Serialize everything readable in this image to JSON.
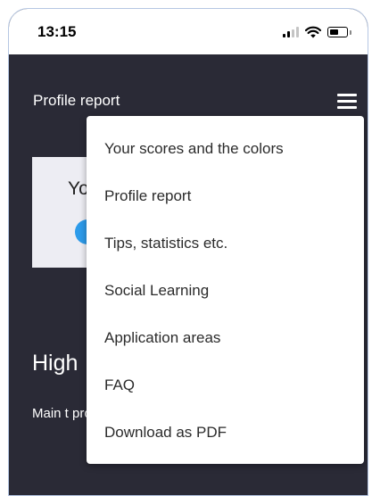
{
  "status_bar": {
    "time": "13:15",
    "icons": [
      "signal-icon",
      "wifi-icon",
      "battery-icon"
    ]
  },
  "header": {
    "title": "Profile report",
    "menu_icon": "hamburger-menu-icon"
  },
  "background_content": {
    "card_text": "Yo",
    "section_heading": "High",
    "section_body": "Main t profile"
  },
  "menu": {
    "items": [
      {
        "label": "Your scores and the colors"
      },
      {
        "label": "Profile report"
      },
      {
        "label": "Tips, statistics etc."
      },
      {
        "label": "Social Learning"
      },
      {
        "label": "Application areas"
      },
      {
        "label": "FAQ"
      },
      {
        "label": "Download as PDF"
      }
    ]
  },
  "colors": {
    "app_background": "#2a2a36",
    "menu_background": "#ffffff",
    "accent_dot": "#2d9bea",
    "card_background": "#ededf3"
  }
}
